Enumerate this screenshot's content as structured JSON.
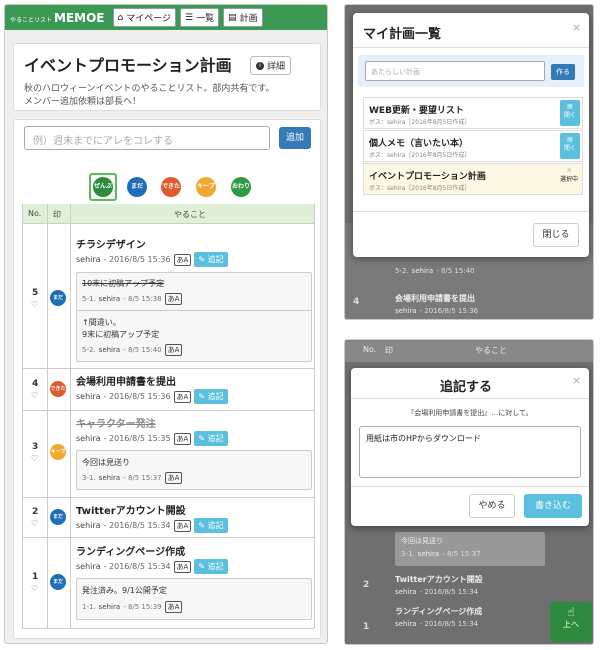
{
  "app": {
    "logo_small": "やることリスト",
    "logo_main": "MEMOE"
  },
  "nav": [
    {
      "label": "マイページ",
      "icon": "home-icon"
    },
    {
      "label": "一覧",
      "icon": "list-icon"
    },
    {
      "label": "計画",
      "icon": "book-icon"
    }
  ],
  "plan": {
    "title": "イベントプロモーション計画",
    "detail_label": "詳細",
    "desc_lines": [
      "秋のハロウィーンイベントのやることリスト。部内共有です。",
      "メンバー追加依頼は部長へ！"
    ]
  },
  "new_todo": {
    "placeholder": "例）週末までにアレをコレする",
    "add_label": "追加"
  },
  "stamps": [
    {
      "label": "ぜんぶ",
      "color": "#2d8a3e"
    },
    {
      "label": "まだ",
      "color": "#1f6fb8"
    },
    {
      "label": "できた",
      "color": "#e05a2b"
    },
    {
      "label": "キープ",
      "color": "#f0a830"
    },
    {
      "label": "おわり",
      "color": "#2e9a43"
    }
  ],
  "table": {
    "col_no": "No.",
    "col_stamp": "印",
    "col_task": "やること"
  },
  "todos": [
    {
      "no": "5",
      "title": "チラシデザイン",
      "author": "sehira",
      "date": "- 2016/8/5 15:36",
      "aa": "あA",
      "append": "追記",
      "stamp": "まだ",
      "stamp_color": "#1f6fb8",
      "notes": [
        {
          "lines": [
            "10末に初稿アップ予定"
          ],
          "struck": true,
          "idx": "5-1.",
          "author": "sehira",
          "date": "- 8/5 15:38",
          "aa": "あA"
        },
        {
          "lines": [
            "↑間違い。",
            "9末に初稿アップ予定"
          ],
          "struck": false,
          "idx": "5-2.",
          "author": "sehira",
          "date": "- 8/5 15:40",
          "aa": "あA"
        }
      ]
    },
    {
      "no": "4",
      "title": "会場利用申請書を提出",
      "author": "sehira",
      "date": "- 2016/8/5 15:36",
      "aa": "あA",
      "append": "追記",
      "stamp": "できた",
      "stamp_color": "#e05a2b",
      "notes": []
    },
    {
      "no": "3",
      "title": "キャラクター発注",
      "author": "sehira",
      "date": "- 2016/8/5 15:35",
      "aa": "あA",
      "append": "追記",
      "stamp": "キープ",
      "stamp_color": "#f0a830",
      "notes": [
        {
          "lines": [
            "今回は見送り"
          ],
          "struck": false,
          "idx": "3-1.",
          "author": "sehira",
          "date": "- 8/5 15:37",
          "aa": "あA"
        }
      ]
    },
    {
      "no": "2",
      "title": "Twitterアカウント開設",
      "author": "sehira",
      "date": "- 2016/8/5 15:34",
      "aa": "あA",
      "append": "追記",
      "stamp": "まだ",
      "stamp_color": "#1f6fb8",
      "notes": []
    },
    {
      "no": "1",
      "title": "ランディングページ作成",
      "author": "sehira",
      "date": "- 2016/8/5 15:34",
      "aa": "あA",
      "append": "追記",
      "stamp": "まだ",
      "stamp_color": "#1f6fb8",
      "notes": [
        {
          "lines": [
            "発注済み。9/1公開予定"
          ],
          "struck": false,
          "idx": "1-1.",
          "author": "sehira",
          "date": "- 8/5 15:39",
          "aa": "あA"
        }
      ]
    }
  ],
  "plans_modal": {
    "title": "マイ計画一覧",
    "new_placeholder": "あたらしい計画",
    "create_label": "作る",
    "plans": [
      {
        "name": "WEB更新・要望リスト",
        "meta": "ボス：sehira［2016年8月5日作成］",
        "action": "開く",
        "active": false
      },
      {
        "name": "個人メモ（言いたい本）",
        "meta": "ボス：sehira［2016年8月5日作成］",
        "action": "開く",
        "active": false
      },
      {
        "name": "イベントプロモーション計画",
        "meta": "ボス：sehira［2016年8月5日作成］",
        "action": "選択中",
        "active": true
      }
    ],
    "close_label": "閉じる"
  },
  "bg_top": {
    "note_idx": "5-2.",
    "note_author": "sehira",
    "note_date": "- 8/5 15:40",
    "row_no": "4",
    "row_title": "会場利用申請書を提出",
    "row_author": "sehira",
    "row_date": "- 2016/8/5 15:36"
  },
  "append_modal": {
    "title": "追記する",
    "subtitle": "『会場利用申請書を提出』…に対して。",
    "text": "用紙は市のHPからダウンロード",
    "cancel_label": "やめる",
    "submit_label": "書き込む"
  },
  "bg_bottom": {
    "col_no": "No.",
    "col_stamp": "印",
    "col_task": "やること",
    "note_text": "今回は見送り",
    "note_idx": "3-1.",
    "note_author": "sehira",
    "note_date": "- 8/5 15:37",
    "row2_no": "2",
    "row2_title": "Twitterアカウント開設",
    "row2_author": "sehira",
    "row2_date": "- 2016/8/5 15:34",
    "row1_no": "1",
    "row1_title": "ランディングページ作成",
    "row1_author": "sehira",
    "row1_date": "- 2016/8/5 15:34",
    "up_label": "上へ"
  }
}
